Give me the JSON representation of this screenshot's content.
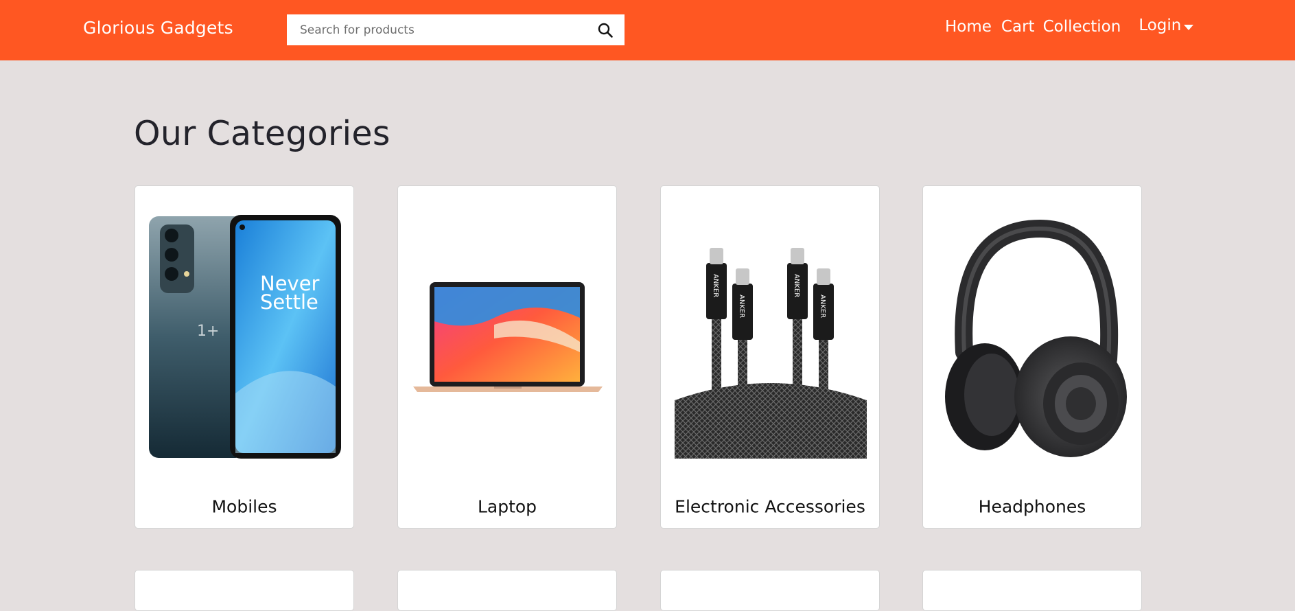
{
  "brand": "Glorious Gadgets",
  "search": {
    "placeholder": "Search for products",
    "icon": "search-icon"
  },
  "nav": {
    "home": "Home",
    "cart": "Cart",
    "collection": "Collection",
    "login": "Login"
  },
  "colors": {
    "accent": "#ff5722",
    "page_background": "#e4dfdf",
    "card_background": "#ffffff"
  },
  "page": {
    "heading": "Our Categories"
  },
  "categories": [
    {
      "label": "Mobiles",
      "image": "smartphone-image"
    },
    {
      "label": "Laptop",
      "image": "laptop-image"
    },
    {
      "label": "Electronic Accessories",
      "image": "usb-c-cables-image"
    },
    {
      "label": "Headphones",
      "image": "headphones-image"
    }
  ]
}
